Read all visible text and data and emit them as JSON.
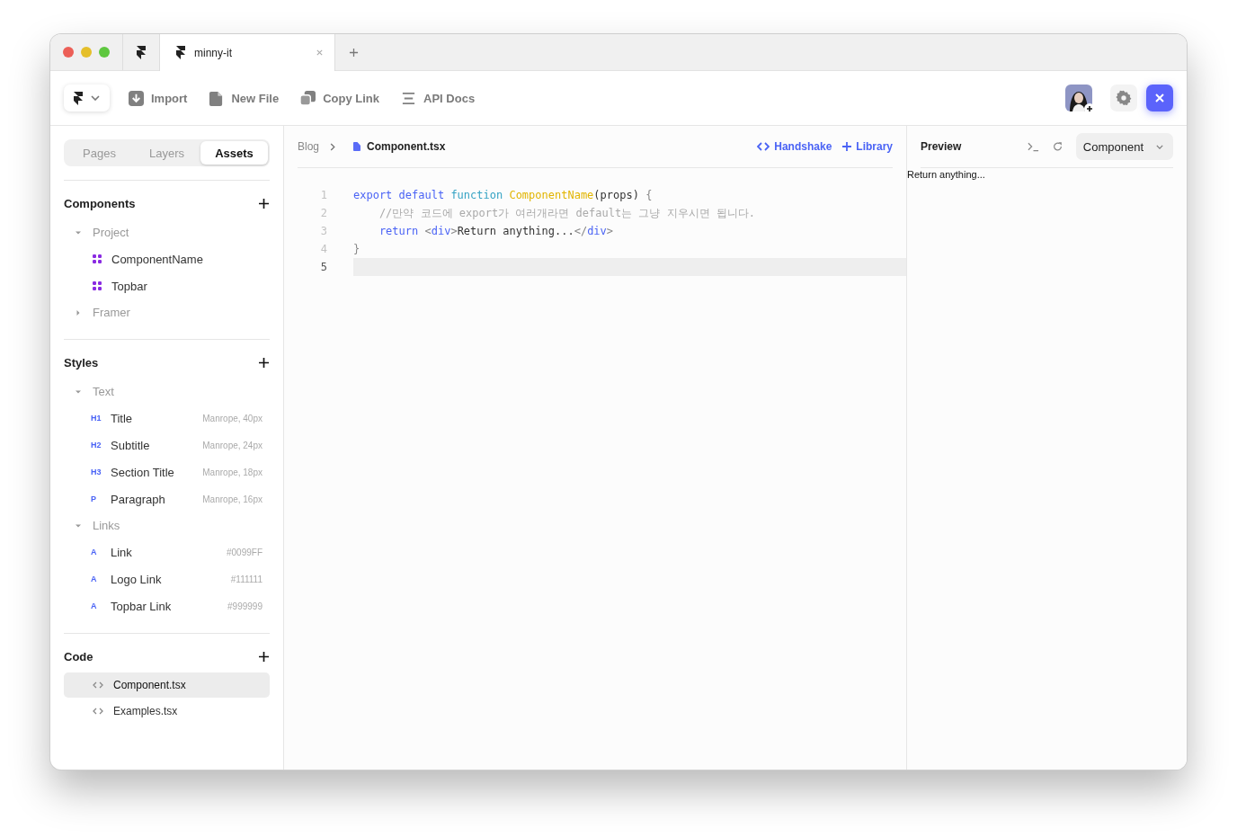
{
  "browser_tabs": [
    {
      "label": "minny-it",
      "selected": true
    }
  ],
  "toolbar": {
    "actions": [
      {
        "kind": "import",
        "label": "Import"
      },
      {
        "kind": "file",
        "label": "New File"
      },
      {
        "kind": "copy",
        "label": "Copy Link"
      },
      {
        "kind": "docs",
        "label": "API Docs"
      }
    ]
  },
  "sidebar": {
    "tabs": [
      {
        "label": "Pages",
        "selected": false
      },
      {
        "label": "Layers",
        "selected": false
      },
      {
        "label": "Assets",
        "selected": true
      }
    ],
    "sections": [
      {
        "title": "Components",
        "groups": [
          {
            "label": "Project",
            "expanded": true,
            "items": [
              {
                "kind": "component",
                "label": "ComponentName"
              },
              {
                "kind": "component",
                "label": "Topbar"
              }
            ]
          },
          {
            "label": "Framer",
            "expanded": false
          }
        ]
      },
      {
        "title": "Styles",
        "groups": [
          {
            "label": "Text",
            "expanded": true,
            "items": [
              {
                "kind": "style",
                "badge": "H1",
                "label": "Title",
                "detail": "Manrope, 40px"
              },
              {
                "kind": "style",
                "badge": "H2",
                "label": "Subtitle",
                "detail": "Manrope, 24px"
              },
              {
                "kind": "style",
                "badge": "H3",
                "label": "Section Title",
                "detail": "Manrope, 18px"
              },
              {
                "kind": "style",
                "badge": "P",
                "label": "Paragraph",
                "detail": "Manrope, 16px"
              }
            ]
          },
          {
            "label": "Links",
            "expanded": true,
            "items": [
              {
                "kind": "style",
                "badge": "A",
                "label": "Link",
                "detail": "#0099FF"
              },
              {
                "kind": "style",
                "badge": "A",
                "label": "Logo Link",
                "detail": "#111111"
              },
              {
                "kind": "style",
                "badge": "A",
                "label": "Topbar Link",
                "detail": "#999999"
              }
            ]
          }
        ]
      },
      {
        "title": "Code",
        "files": [
          {
            "label": "Component.tsx",
            "selected": true
          },
          {
            "label": "Examples.tsx",
            "selected": false
          }
        ]
      }
    ]
  },
  "editor": {
    "breadcrumb": [
      "Blog",
      "Component.tsx"
    ],
    "actions": [
      {
        "kind": "code",
        "label": "Handshake"
      },
      {
        "kind": "add",
        "label": "Library"
      }
    ],
    "lines": [
      {
        "number": "1",
        "active": false,
        "tokens": [
          {
            "kind": "keyword",
            "text": "export default "
          },
          {
            "kind": "fn",
            "text": "function "
          },
          {
            "kind": "name",
            "text": "ComponentName"
          },
          {
            "kind": "plain",
            "text": "(props) "
          },
          {
            "kind": "punct",
            "text": "{"
          }
        ]
      },
      {
        "number": "2",
        "active": false,
        "tokens": [
          {
            "kind": "comment",
            "text": "    //만약 코드에 export가 여러개라면 default는 그냥 지우시면 됩니다."
          }
        ]
      },
      {
        "number": "3",
        "active": false,
        "tokens": [
          {
            "kind": "keyword",
            "text": "    return "
          },
          {
            "kind": "punct",
            "text": "<"
          },
          {
            "kind": "keyword",
            "text": "div"
          },
          {
            "kind": "punct",
            "text": ">"
          },
          {
            "kind": "plain",
            "text": "Return anything..."
          },
          {
            "kind": "punct",
            "text": "</"
          },
          {
            "kind": "keyword",
            "text": "div"
          },
          {
            "kind": "punct",
            "text": ">"
          }
        ]
      },
      {
        "number": "4",
        "active": false,
        "tokens": [
          {
            "kind": "punct",
            "text": "}"
          }
        ]
      },
      {
        "number": "5",
        "active": true
      }
    ]
  },
  "preview": {
    "title": "Preview",
    "dropdown": "Component",
    "output": "Return anything..."
  }
}
